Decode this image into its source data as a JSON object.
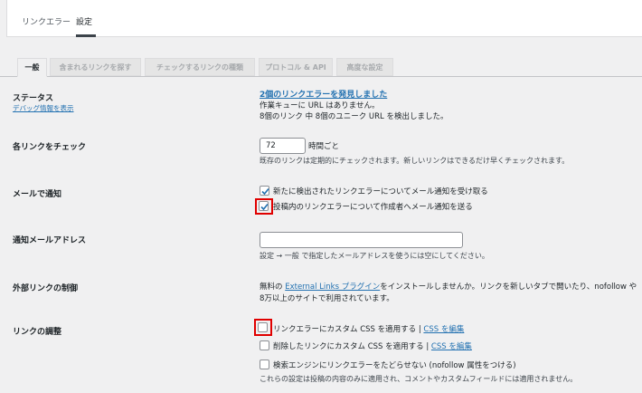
{
  "top_tabs": [
    "リンクエラー",
    "設定"
  ],
  "settings_tabs": [
    "一般",
    "含まれるリンクを探す",
    "チェックするリンクの種類",
    "プロトコル & API",
    "高度な設定"
  ],
  "status": {
    "label": "ステータス",
    "debug_link": "デバッグ情報を表示",
    "found_link": "2個のリンクエラーを発見しました",
    "queue_text": "作業キューに URL はありません。",
    "detected_text": "8個のリンク 中 8個のユニーク URL を検出しました。"
  },
  "check_each": {
    "label": "各リンクをチェック",
    "value": "72",
    "unit": "時間ごと",
    "hint": "既存のリンクは定期的にチェックされます。新しいリンクはできるだけ早くチェックされます。"
  },
  "mail_notify": {
    "label": "メールで通知",
    "option1": "新たに検出されたリンクエラーについてメール通知を受け取る",
    "option1_checked": true,
    "option2": "投稿内のリンクエラーについて作成者へメール通知を送る",
    "option2_checked": true
  },
  "notify_email": {
    "label": "通知メールアドレス",
    "value": "",
    "hint": "設定 → 一般 で指定したメールアドレスを使うには空にしてください。"
  },
  "external": {
    "label": "外部リンクの制御",
    "prefix": "無料の",
    "link": "External Links プラグイン",
    "suffix": "をインストールしませんか。リンクを新しいタブで開いたり、nofollow や",
    "line2": "8万以上のサイトで利用されています。"
  },
  "adjust": {
    "label": "リンクの調整",
    "option1": "リンクエラーにカスタム CSS を適用する",
    "option1_link": "CSS を編集",
    "option2": "削除したリンクにカスタム CSS を適用する",
    "option2_link": "CSS を編集",
    "option3": "検索エンジンにリンクエラーをたどらせない (nofollow 属性をつける)",
    "note": "これらの設定は投稿の内容のみに適用され、コメントやカスタムフィールドには適用されません。",
    "sep": "|"
  },
  "colors": {
    "accent": "#2271b1",
    "highlight": "#e00000"
  }
}
